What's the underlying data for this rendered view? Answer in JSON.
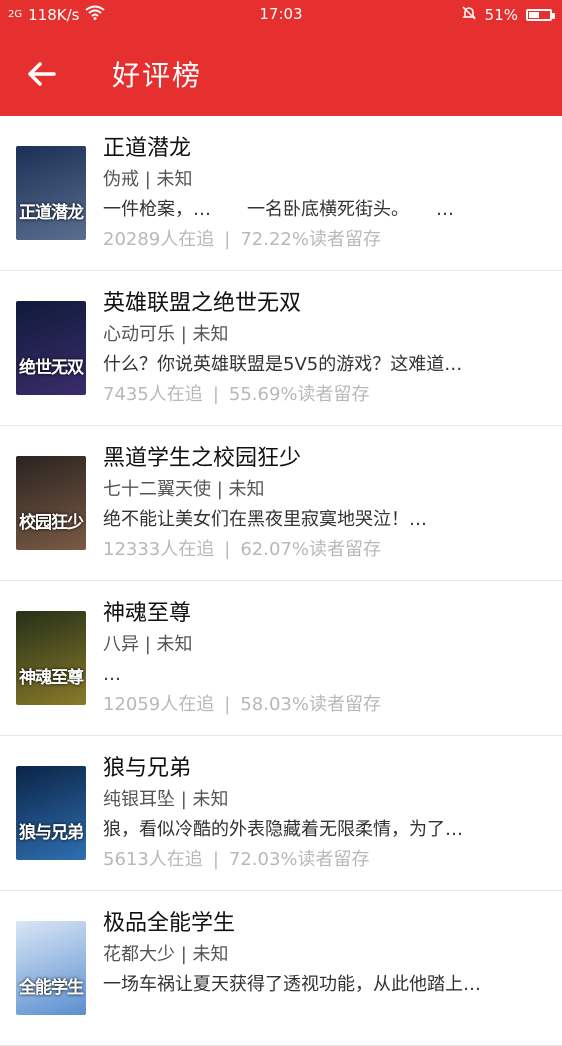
{
  "status": {
    "signal": "2G",
    "speed": "118K/s",
    "time": "17:03",
    "battery": "51%",
    "battery_level": 0.51
  },
  "header": {
    "back_icon": "arrow-left-icon",
    "title": "好评榜"
  },
  "books": [
    {
      "title": "正道潜龙",
      "meta": "伪戒 | 未知",
      "intro": "一件枪案，…　　一名卧底横死街头。　　…",
      "followers": "20289人在追",
      "retention": "72.22%读者留存",
      "cover_text": "正道潜龙",
      "cover_bg": [
        "#1c2f55",
        "#5a6f90"
      ]
    },
    {
      "title": "英雄联盟之绝世无双",
      "meta": "心动可乐 | 未知",
      "intro": "什么？你说英雄联盟是5V5的游戏？这难道…",
      "followers": "7435人在追",
      "retention": "55.69%读者留存",
      "cover_text": "绝世无双",
      "cover_bg": [
        "#0f1b3a",
        "#3b2c6b"
      ]
    },
    {
      "title": "黑道学生之校园狂少",
      "meta": "七十二翼天使 | 未知",
      "intro": "绝不能让美女们在黑夜里寂寞地哭泣！…",
      "followers": "12333人在追",
      "retention": "62.07%读者留存",
      "cover_text": "校园狂少",
      "cover_bg": [
        "#2a2320",
        "#7a5b45"
      ]
    },
    {
      "title": "神魂至尊",
      "meta": "八异 | 未知",
      "intro": "…",
      "followers": "12059人在追",
      "retention": "58.03%读者留存",
      "cover_text": "神魂至尊",
      "cover_bg": [
        "#243018",
        "#8a7a2a"
      ]
    },
    {
      "title": "狼与兄弟",
      "meta": "纯银耳坠 | 未知",
      "intro": "狼，看似冷酷的外表隐藏着无限柔情，为了…",
      "followers": "5613人在追",
      "retention": "72.03%读者留存",
      "cover_text": "狼与兄弟",
      "cover_bg": [
        "#0b2447",
        "#2f6fb0"
      ]
    },
    {
      "title": "极品全能学生",
      "meta": "花都大少 | 未知",
      "intro": "一场车祸让夏天获得了透视功能，从此他踏上…",
      "followers": "",
      "retention": "",
      "cover_text": "全能学生",
      "cover_bg": [
        "#d9e6f5",
        "#5b8fd0"
      ]
    }
  ]
}
